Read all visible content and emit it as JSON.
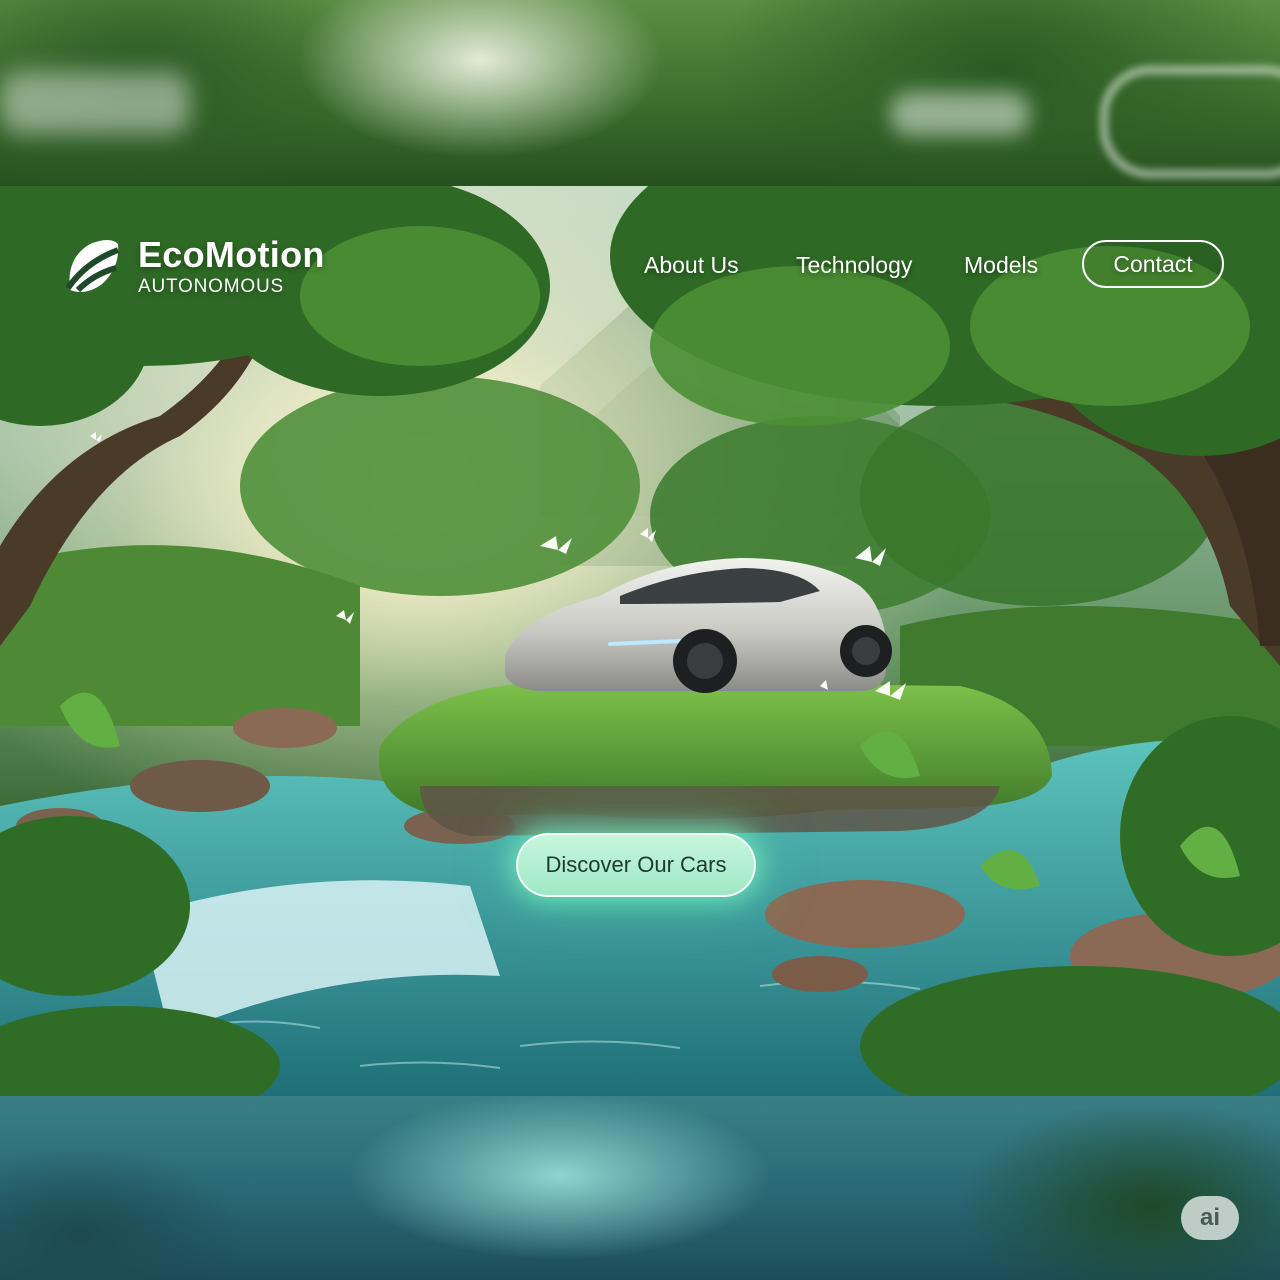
{
  "brand": {
    "name": "EcoMotion",
    "tagline": "AUTONOMOUS",
    "logo_icon": "leaf-logo-icon"
  },
  "nav": {
    "items": [
      {
        "label": "About Us"
      },
      {
        "label": "Technology"
      },
      {
        "label": "Models"
      }
    ],
    "contact_label": "Contact"
  },
  "hero": {
    "cta_label": "Discover Our Cars"
  },
  "badge": {
    "label": "ai"
  },
  "colors": {
    "cta_fill": "#b4f0d2",
    "cta_glow": "#78f0be",
    "nav_text": "#ffffff",
    "foliage": "#3f7a2e",
    "water": "#3aa6a8"
  }
}
